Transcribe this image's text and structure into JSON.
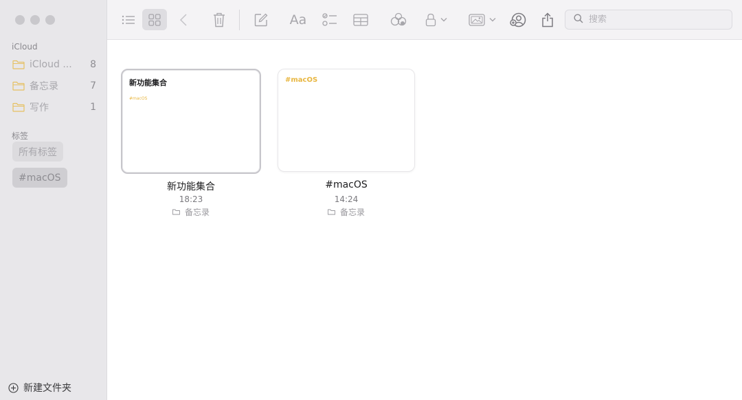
{
  "sidebar": {
    "icloud_label": "iCloud",
    "folders": [
      {
        "name": "iCloud ...",
        "count": "8"
      },
      {
        "name": "备忘录",
        "count": "7"
      },
      {
        "name": "写作",
        "count": "1"
      }
    ],
    "tags_label": "标签",
    "tags": [
      {
        "label": "所有标签"
      },
      {
        "label": "#macOS"
      }
    ],
    "new_folder_label": "新建文件夹"
  },
  "toolbar": {
    "font_label": "Aa",
    "search_placeholder": "搜索"
  },
  "notes": [
    {
      "title": "新功能集合",
      "time": "18:23",
      "folder": "备忘录",
      "preview_title": "新功能集合",
      "preview_tag": "#macOS"
    },
    {
      "title": "#macOS",
      "time": "14:24",
      "folder": "备忘录",
      "preview_tag": "#macOS"
    }
  ],
  "colors": {
    "tag_accent": "#e8b640",
    "folder_icon": "#e6c062",
    "sidebar_bg": "#e8e7ea"
  }
}
